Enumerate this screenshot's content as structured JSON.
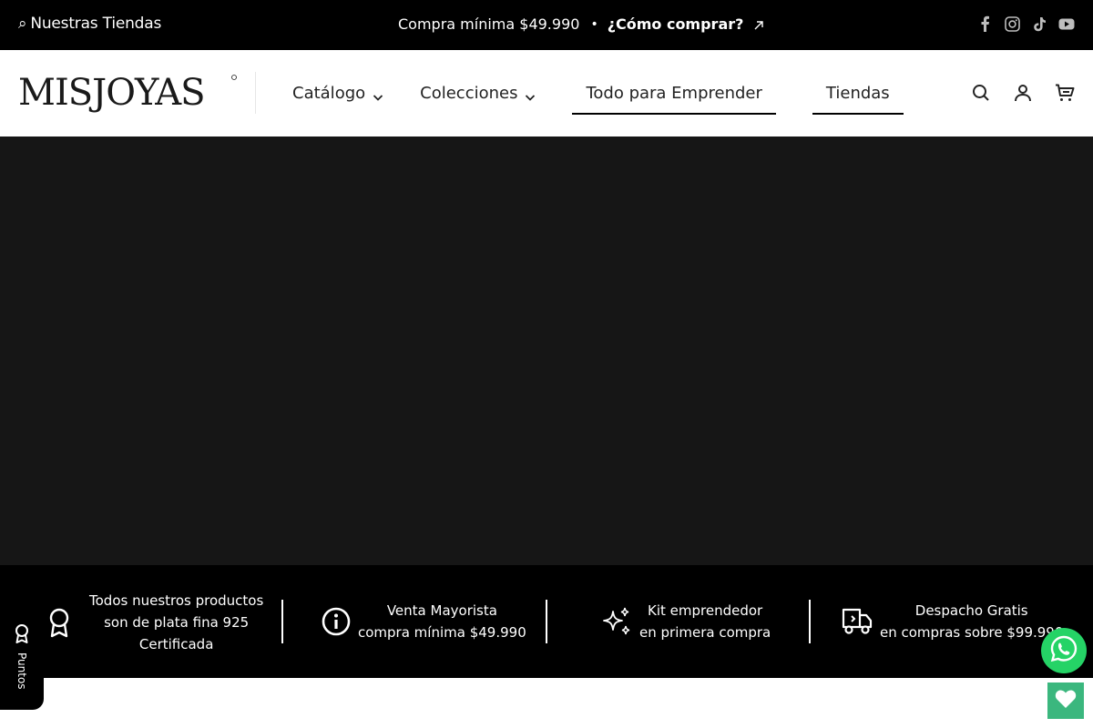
{
  "topbar": {
    "stores_label": "Nuestras Tiendas",
    "promo_text": "Compra mínima $49.990",
    "separator": "•",
    "how_to_buy": "¿Cómo comprar?",
    "social": [
      "facebook-icon",
      "instagram-icon",
      "tiktok-icon",
      "youtube-icon"
    ]
  },
  "header": {
    "logo_text": "MISJOYAS",
    "nav": {
      "catalog": "Catálogo",
      "collections": "Colecciones",
      "emprender": "Todo para Emprender",
      "tiendas": "Tiendas"
    },
    "icons": [
      "search-icon",
      "account-icon",
      "cart-icon"
    ]
  },
  "features": [
    {
      "icon": "award-ribbon-icon",
      "line1": "Todos nuestros productos",
      "line2": "son de plata fina 925",
      "line3": "Certificada"
    },
    {
      "icon": "info-icon",
      "line1": "Venta Mayorista",
      "line2": "compra mínima $49.990"
    },
    {
      "icon": "sparkles-icon",
      "line1": "Kit emprendedor",
      "line2": "en primera compra"
    },
    {
      "icon": "delivery-truck-icon",
      "line1": "Despacho Gratis",
      "line2": "en compras sobre $99.990"
    }
  ],
  "floating": {
    "points_label": "Puntos"
  },
  "colors": {
    "topbar_bg": "#000000",
    "hero_bg": "#161616",
    "whatsapp": "#25d366",
    "wishlist": "#3bb77e"
  }
}
